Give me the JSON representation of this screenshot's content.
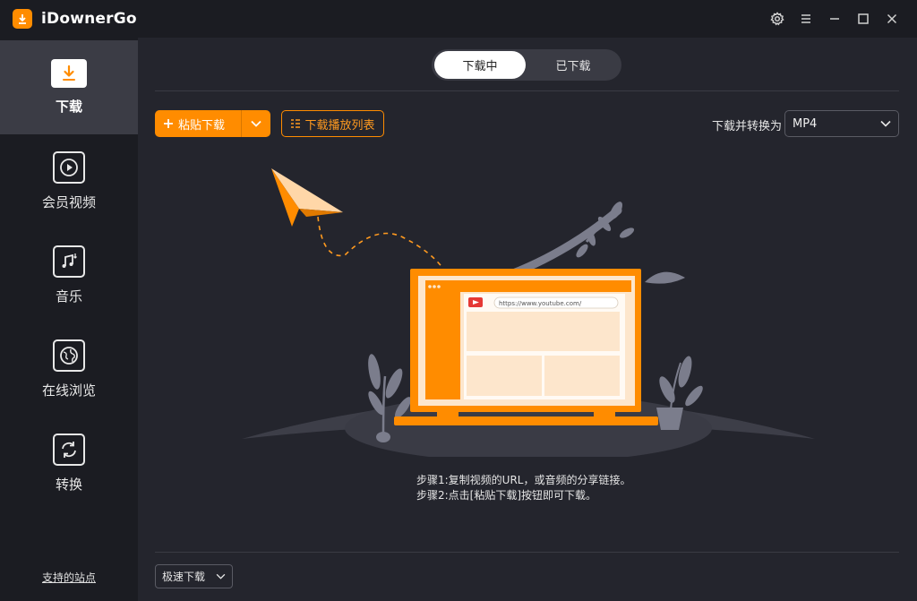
{
  "app": {
    "title": "iDownerGo"
  },
  "window_controls": [
    "gear-icon",
    "menu-icon",
    "minimize-icon",
    "maximize-icon",
    "close-icon"
  ],
  "sidebar": {
    "items": [
      {
        "label": "下载",
        "icon": "download-icon",
        "active": true
      },
      {
        "label": "会员视频",
        "icon": "play-icon",
        "active": false
      },
      {
        "label": "音乐",
        "icon": "music-icon",
        "active": false
      },
      {
        "label": "在线浏览",
        "icon": "globe-icon",
        "active": false
      },
      {
        "label": "转换",
        "icon": "convert-icon",
        "active": false
      }
    ],
    "supported_sites": "支持的站点"
  },
  "tabs": [
    {
      "label": "下载中",
      "active": true
    },
    {
      "label": "已下载",
      "active": false
    }
  ],
  "toolbar": {
    "paste_label": "粘贴下载",
    "playlist_label": "下载播放列表",
    "convert_label": "下载并转换为",
    "format_value": "MP4"
  },
  "illustration": {
    "url_text": "https://www.youtube.com/"
  },
  "steps": {
    "step1": "步骤1:复制视频的URL，或音频的分享链接。",
    "step2": "步骤2:点击[粘贴下载]按钮即可下载。"
  },
  "footer": {
    "speed_value": "极速下载"
  },
  "colors": {
    "accent": "#ff8c00",
    "background": "#24252d",
    "sidebar": "#1b1c22",
    "active_item": "#3b3c45"
  }
}
